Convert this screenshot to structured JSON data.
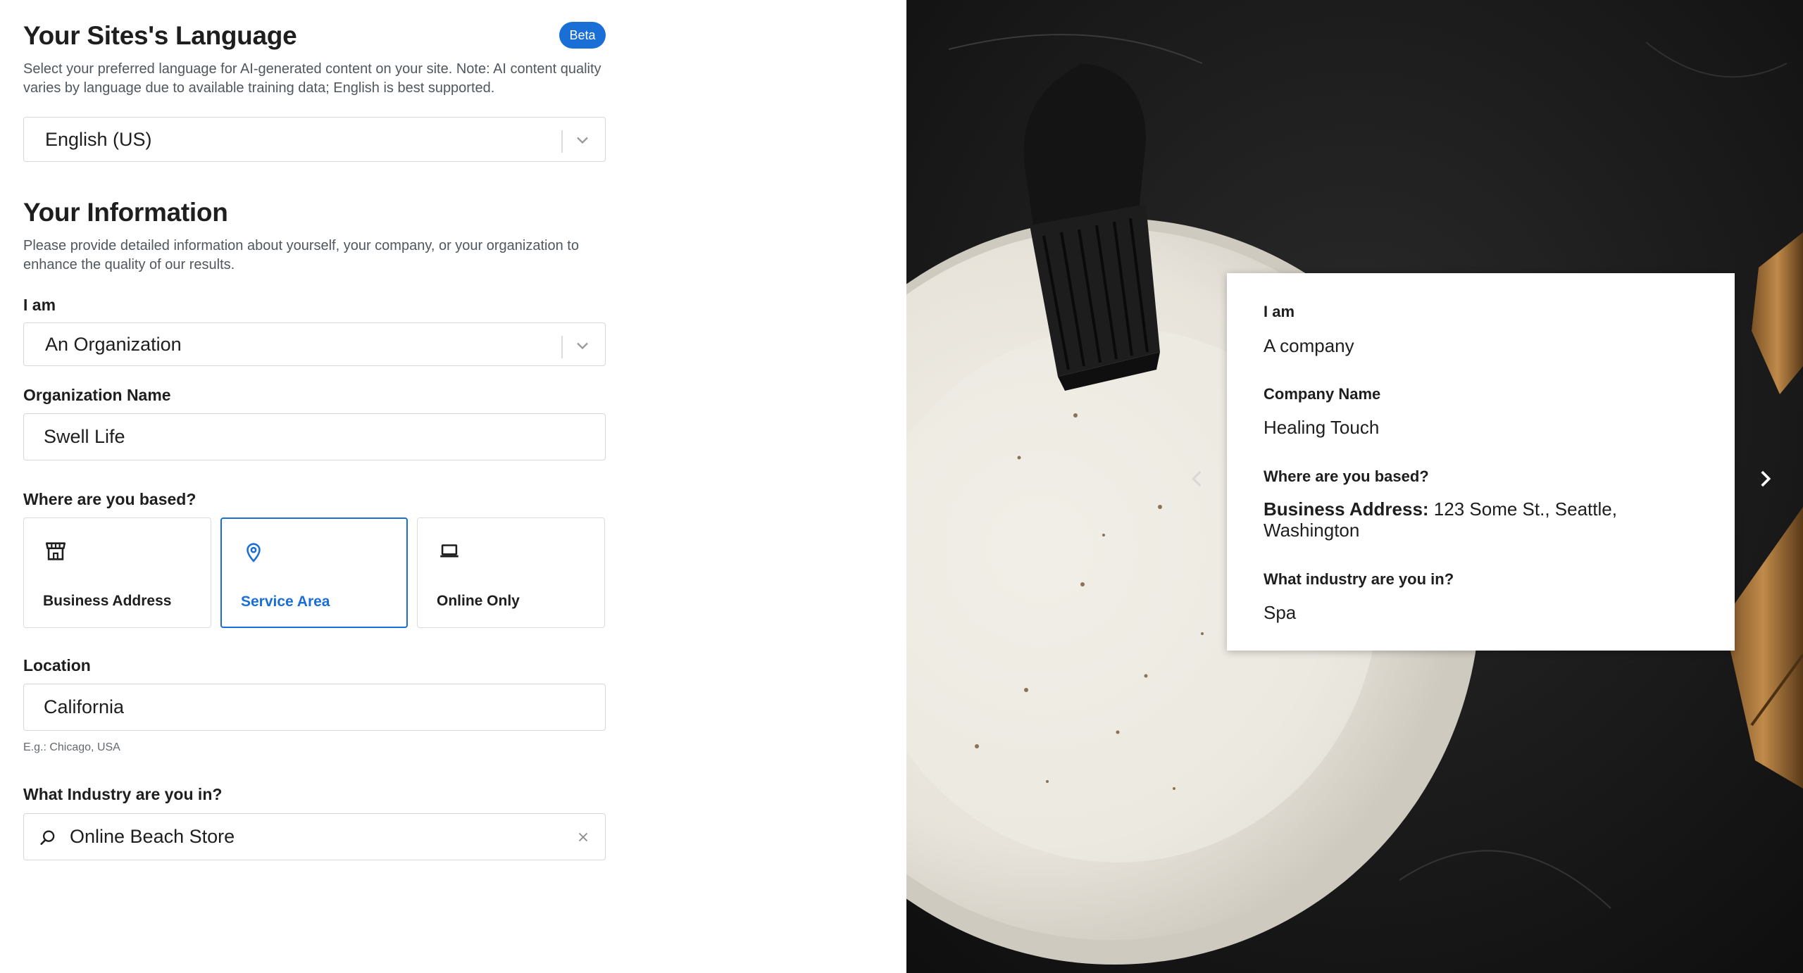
{
  "language_section": {
    "title": "Your Sites's Language",
    "badge": "Beta",
    "description": "Select your preferred language for AI-generated content on your site. Note: AI content quality varies by language due to available training data; English is best supported.",
    "selected_language": "English (US)"
  },
  "info_section": {
    "title": "Your Information",
    "description": "Please provide detailed information about yourself, your company, or your organization to enhance the quality of our results."
  },
  "form": {
    "i_am_label": "I am",
    "i_am_value": "An Organization",
    "org_name_label": "Organization Name",
    "org_name_value": "Swell Life",
    "based_label": "Where are you based?",
    "based_options": [
      {
        "label": "Business Address",
        "icon": "store-icon",
        "selected": false
      },
      {
        "label": "Service Area",
        "icon": "location-pin-icon",
        "selected": true
      },
      {
        "label": "Online Only",
        "icon": "laptop-icon",
        "selected": false
      }
    ],
    "location_label": "Location",
    "location_value": "California",
    "location_hint": "E.g.: Chicago, USA",
    "industry_label": "What Industry are you in?",
    "industry_value": "Online Beach Store"
  },
  "preview_card": {
    "i_am_label": "I am",
    "i_am_value": "A company",
    "company_label": "Company Name",
    "company_value": "Healing Touch",
    "based_label": "Where are you based?",
    "based_prefix": "Business Address:",
    "based_value": "123 Some St., Seattle, Washington",
    "industry_label": "What industry are you in?",
    "industry_value": "Spa"
  },
  "colors": {
    "accent": "#1a6fd6",
    "text": "#1e1e1e",
    "muted": "#50575e",
    "border": "#d8d8d8"
  }
}
